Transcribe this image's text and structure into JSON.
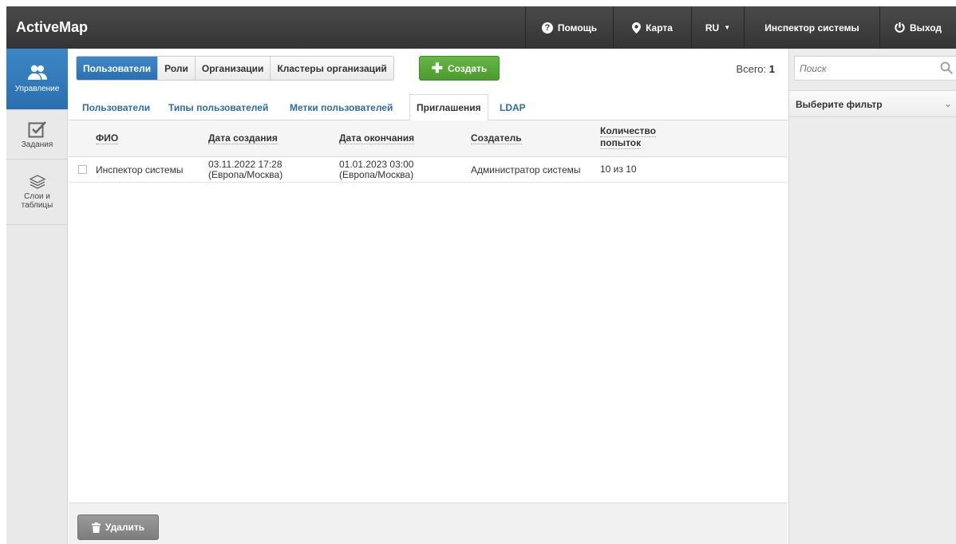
{
  "app": {
    "title": "ActiveMap"
  },
  "topnav": {
    "help": "Помощь",
    "map": "Карта",
    "lang": "RU",
    "user": "Инспектор системы",
    "logout": "Выход"
  },
  "sidebar": {
    "items": [
      {
        "label": "Управление",
        "icon": "users-icon"
      },
      {
        "label": "Задания",
        "icon": "checkbox-icon"
      },
      {
        "label": "Слои и таблицы",
        "icon": "layers-icon"
      }
    ]
  },
  "main": {
    "segments": [
      "Пользователи",
      "Роли",
      "Организации",
      "Кластеры организаций"
    ],
    "create_label": "Создать",
    "total_label": "Всего:",
    "total_value": "1",
    "subtabs": [
      "Пользователи",
      "Типы пользователей",
      "Метки пользователей",
      "Приглашения",
      "LDAP"
    ],
    "columns": [
      "ФИО",
      "Дата создания",
      "Дата окончания",
      "Создатель",
      "Количество попыток"
    ],
    "rows": [
      {
        "name": "Инспектор системы",
        "created_date": "03.11.2022 17:28",
        "created_tz": "(Европа/Москва)",
        "end_date": "01.01.2023 03:00",
        "end_tz": "(Европа/Москва)",
        "creator": "Администратор системы",
        "attempts": "10 из 10"
      }
    ],
    "delete_label": "Удалить"
  },
  "right": {
    "search_placeholder": "Поиск",
    "filter_label": "Выберите фильтр"
  },
  "colors": {
    "topbar": "#3a3a3a",
    "accent_blue": "#2f77b9",
    "create_green": "#55a836",
    "delete_gray": "#8a8a8a"
  }
}
